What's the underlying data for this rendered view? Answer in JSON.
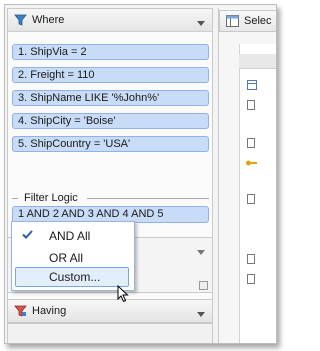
{
  "where_panel": {
    "title": "Where",
    "conditions": [
      "1. ShipVia = 2",
      "2. Freight = 110",
      "3. ShipName LIKE '%John%'",
      "4. ShipCity = 'Boise'",
      "5. ShipCountry = 'USA'"
    ],
    "filter_logic_label": "Filter Logic",
    "filter_logic_value": "1 AND 2 AND 3 AND 4 AND 5"
  },
  "logic_menu": {
    "items": [
      "AND All",
      "OR All",
      "Custom..."
    ],
    "checked_index": 0,
    "hovered_index": 2
  },
  "having_panel": {
    "title": "Having"
  },
  "select_tab": {
    "label": "Selec"
  },
  "colors": {
    "condition_bg": "#c8dcf7",
    "condition_border": "#8fb3e6",
    "menu_hover": "#e3eefb"
  },
  "icons": [
    "funnel-icon",
    "chevron-down-icon",
    "check-icon",
    "mouse-cursor-icon",
    "select-tab-icon"
  ]
}
